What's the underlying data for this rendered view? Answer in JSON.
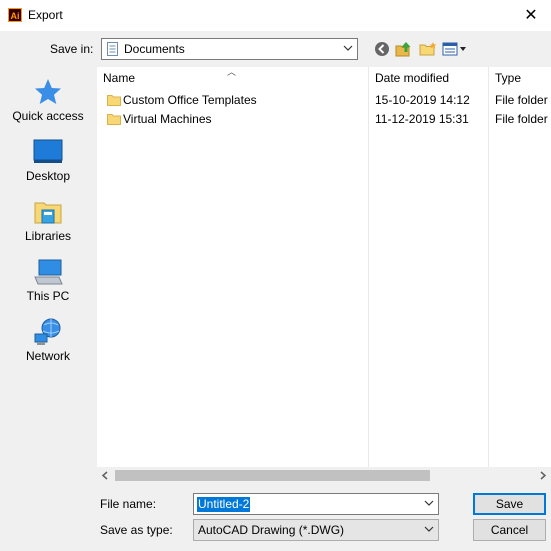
{
  "window": {
    "title": "Export",
    "close": "✕"
  },
  "toolbar": {
    "save_in_label": "Save in:",
    "save_in_value": "Documents"
  },
  "places": [
    {
      "label": "Quick access"
    },
    {
      "label": "Desktop"
    },
    {
      "label": "Libraries"
    },
    {
      "label": "This PC"
    },
    {
      "label": "Network"
    }
  ],
  "columns": {
    "name": "Name",
    "date": "Date modified",
    "type": "Type"
  },
  "files": [
    {
      "name": "Custom Office Templates",
      "date": "15-10-2019 14:12",
      "type": "File folder"
    },
    {
      "name": "Virtual Machines",
      "date": "11-12-2019 15:31",
      "type": "File folder"
    }
  ],
  "form": {
    "file_name_label": "File name:",
    "file_name_value": "Untitled-2",
    "save_as_type_label": "Save as type:",
    "save_as_type_value": "AutoCAD Drawing (*.DWG)"
  },
  "buttons": {
    "save": "Save",
    "cancel": "Cancel"
  },
  "colors": {
    "accent": "#0078d7",
    "folder": "#f8d775"
  }
}
